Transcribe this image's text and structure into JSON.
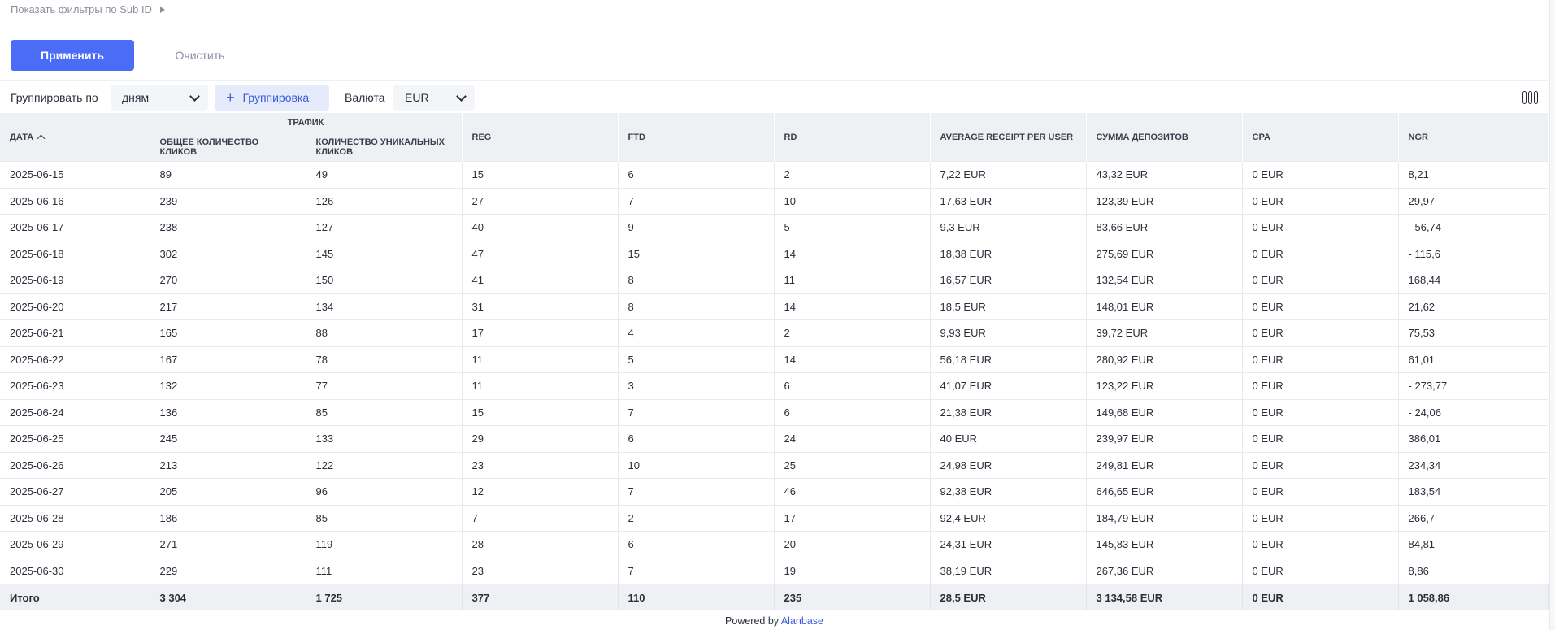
{
  "filters": {
    "toggle_label": "Показать фильтры по Sub ID"
  },
  "actions": {
    "apply_label": "Применить",
    "clear_label": "Очистить"
  },
  "toolbar": {
    "group_by_label": "Группировать по",
    "group_by_value": "дням",
    "grouping_button_label": "Группировка",
    "currency_label": "Валюта",
    "currency_value": "EUR",
    "columns_icon": "columns-icon"
  },
  "table": {
    "headers": {
      "date": "Дата",
      "traffic_group": "Трафик",
      "total_clicks": "Общее количество кликов",
      "unique_clicks": "Количество уникальных кликов",
      "reg": "REG",
      "ftd": "FTD",
      "rd": "RD",
      "avg_receipt": "Average receipt per user",
      "deposits_sum": "Сумма депозитов",
      "cpa": "CPA",
      "ngr": "NGR"
    },
    "rows": [
      [
        "2025-06-15",
        "89",
        "49",
        "15",
        "6",
        "2",
        "7,22 EUR",
        "43,32 EUR",
        "0 EUR",
        "8,21"
      ],
      [
        "2025-06-16",
        "239",
        "126",
        "27",
        "7",
        "10",
        "17,63 EUR",
        "123,39 EUR",
        "0 EUR",
        "29,97"
      ],
      [
        "2025-06-17",
        "238",
        "127",
        "40",
        "9",
        "5",
        "9,3 EUR",
        "83,66 EUR",
        "0 EUR",
        "- 56,74"
      ],
      [
        "2025-06-18",
        "302",
        "145",
        "47",
        "15",
        "14",
        "18,38 EUR",
        "275,69 EUR",
        "0 EUR",
        "- 115,6"
      ],
      [
        "2025-06-19",
        "270",
        "150",
        "41",
        "8",
        "11",
        "16,57 EUR",
        "132,54 EUR",
        "0 EUR",
        "168,44"
      ],
      [
        "2025-06-20",
        "217",
        "134",
        "31",
        "8",
        "14",
        "18,5 EUR",
        "148,01 EUR",
        "0 EUR",
        "21,62"
      ],
      [
        "2025-06-21",
        "165",
        "88",
        "17",
        "4",
        "2",
        "9,93 EUR",
        "39,72 EUR",
        "0 EUR",
        "75,53"
      ],
      [
        "2025-06-22",
        "167",
        "78",
        "11",
        "5",
        "14",
        "56,18 EUR",
        "280,92 EUR",
        "0 EUR",
        "61,01"
      ],
      [
        "2025-06-23",
        "132",
        "77",
        "11",
        "3",
        "6",
        "41,07 EUR",
        "123,22 EUR",
        "0 EUR",
        "- 273,77"
      ],
      [
        "2025-06-24",
        "136",
        "85",
        "15",
        "7",
        "6",
        "21,38 EUR",
        "149,68 EUR",
        "0 EUR",
        "- 24,06"
      ],
      [
        "2025-06-25",
        "245",
        "133",
        "29",
        "6",
        "24",
        "40 EUR",
        "239,97 EUR",
        "0 EUR",
        "386,01"
      ],
      [
        "2025-06-26",
        "213",
        "122",
        "23",
        "10",
        "25",
        "24,98 EUR",
        "249,81 EUR",
        "0 EUR",
        "234,34"
      ],
      [
        "2025-06-27",
        "205",
        "96",
        "12",
        "7",
        "46",
        "92,38 EUR",
        "646,65 EUR",
        "0 EUR",
        "183,54"
      ],
      [
        "2025-06-28",
        "186",
        "85",
        "7",
        "2",
        "17",
        "92,4 EUR",
        "184,79 EUR",
        "0 EUR",
        "266,7"
      ],
      [
        "2025-06-29",
        "271",
        "119",
        "28",
        "6",
        "20",
        "24,31 EUR",
        "145,83 EUR",
        "0 EUR",
        "84,81"
      ],
      [
        "2025-06-30",
        "229",
        "111",
        "23",
        "7",
        "19",
        "38,19 EUR",
        "267,36 EUR",
        "0 EUR",
        "8,86"
      ]
    ],
    "totals": [
      "Итого",
      "3 304",
      "1 725",
      "377",
      "110",
      "235",
      "28,5 EUR",
      "3 134,58 EUR",
      "0 EUR",
      "1 058,86"
    ]
  },
  "footer": {
    "powered_by": "Powered by",
    "brand": "Alanbase"
  },
  "colors": {
    "accent": "#4a6cf7",
    "link": "#3b5bdb",
    "header_bg": "#eef0f4"
  }
}
